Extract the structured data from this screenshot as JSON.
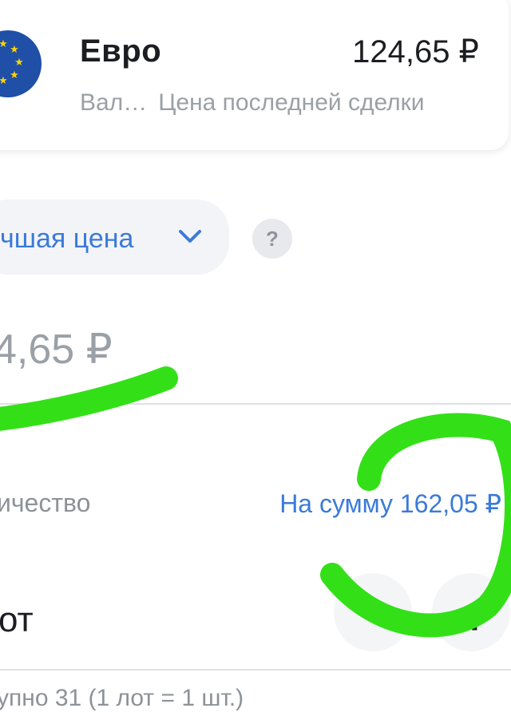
{
  "asset": {
    "name": "Евро",
    "price": "124,65 ₽",
    "type_label": "Вал…",
    "price_caption": "Цена последней сделки"
  },
  "order": {
    "price_mode_label": "чшая цена",
    "help_label": "?",
    "price_value": "4,65 ₽"
  },
  "quantity": {
    "label": "ичество",
    "sum_label": "На сумму 162,05 ₽",
    "lot_value": "от",
    "plus_label": "+",
    "footnote": "упно 31 (1 лот = 1 шт.)"
  },
  "colors": {
    "accent": "#3b7ad9",
    "flag": "#1f4fa7",
    "flag_stars": "#ffd400",
    "annotation": "#33e018"
  },
  "icons": [
    "eu-flag-icon",
    "chevron-down-icon",
    "help-icon",
    "plus-icon"
  ]
}
